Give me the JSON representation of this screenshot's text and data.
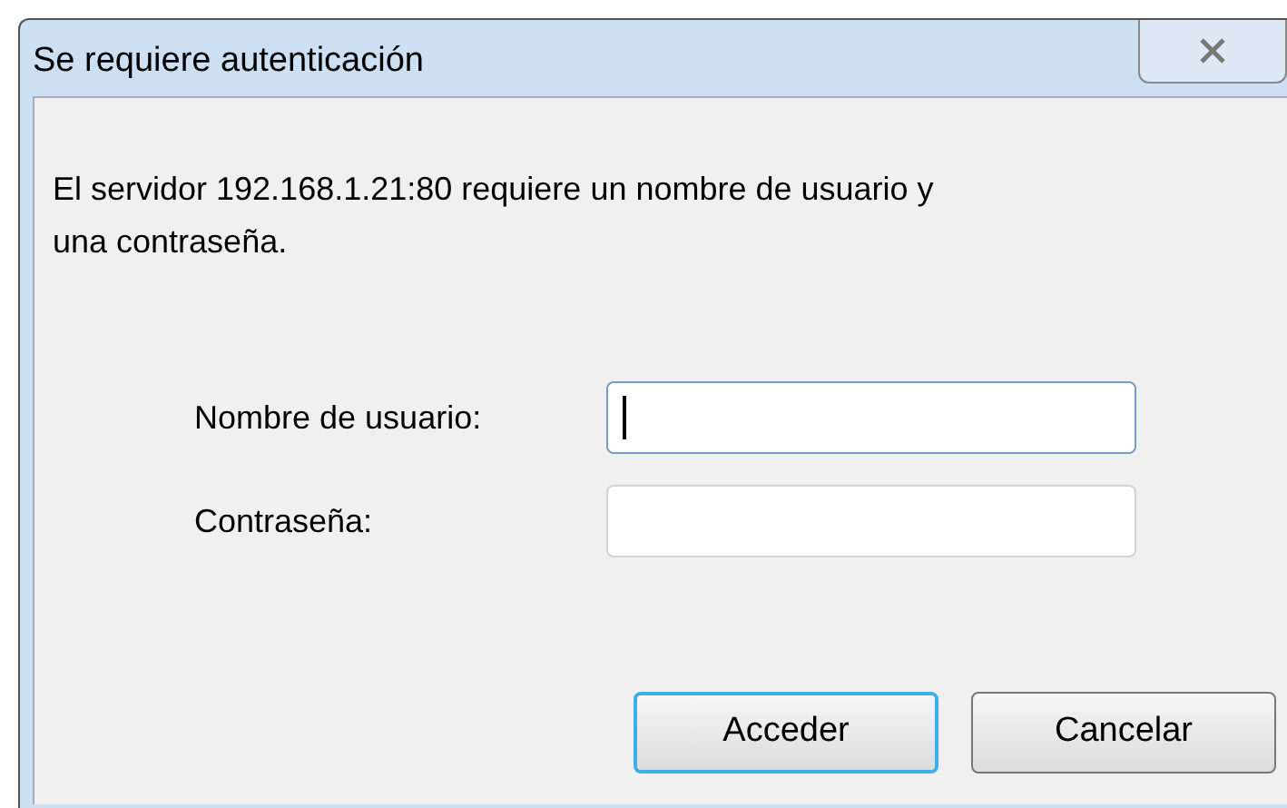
{
  "window": {
    "title": "Se requiere autenticación"
  },
  "message": "El servidor 192.168.1.21:80 requiere un nombre de usuario y una contraseña.",
  "fields": [
    {
      "label": "Nombre de usuario:",
      "focused": true
    },
    {
      "label": "Contraseña:",
      "focused": false
    }
  ],
  "buttons": [
    {
      "label": "Acceder",
      "default": true
    },
    {
      "label": "Cancelar",
      "default": false
    }
  ]
}
